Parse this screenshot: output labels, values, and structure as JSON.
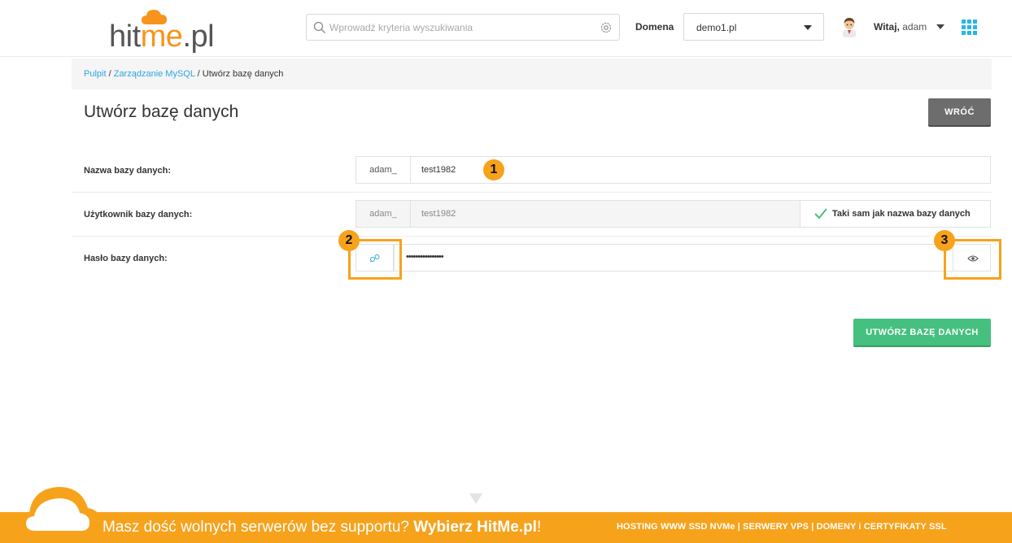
{
  "header": {
    "logo": {
      "part1": "hit",
      "accent": "me",
      "part2": ".pl"
    },
    "search": {
      "placeholder": "Wprowadź kryteria wyszukiwania",
      "value": ""
    },
    "domain_label": "Domena",
    "domain_value": "demo1.pl",
    "welcome_prefix": "Witaj,",
    "username": "adam"
  },
  "breadcrumb": {
    "items": [
      "Pulpit",
      "Zarządzanie MySQL"
    ],
    "separator": "/",
    "current": "Utwórz bazę danych"
  },
  "page": {
    "title": "Utwórz bazę danych",
    "back_label": "WRÓĆ"
  },
  "form": {
    "db_name": {
      "label": "Nazwa bazy danych:",
      "prefix": "adam_",
      "value": "test1982"
    },
    "db_user": {
      "label": "Użytkownik bazy danych:",
      "prefix": "adam_",
      "value": "test1982",
      "same_label": "Taki sam jak nazwa bazy danych",
      "same_checked": true
    },
    "db_password": {
      "label": "Hasło bazy danych:",
      "value": "••••••••••••••••"
    },
    "submit_label": "UTWÓRZ BAZĘ DANYCH"
  },
  "annotations": [
    "1",
    "2",
    "3"
  ],
  "banner": {
    "text_plain": "Masz dość wolnych serwerów bez supportu?",
    "text_bold": "Wybierz HitMe.pl",
    "text_end": "!",
    "right": "HOSTING WWW SSD NVMe | SERWERY VPS | DOMENY i CERTYFIKATY SSL"
  },
  "colors": {
    "accent_orange": "#f7a21b",
    "link_blue": "#29a8e0",
    "create_green": "#45c07f",
    "back_gray": "#6d6d6d"
  },
  "icons": [
    "search-icon",
    "gear-icon",
    "chevron-down-icon",
    "avatar",
    "apps-grid-icon",
    "checkmark-icon",
    "generate-password-icon",
    "eye-icon",
    "cloud-icon",
    "down-arrow-icon"
  ]
}
